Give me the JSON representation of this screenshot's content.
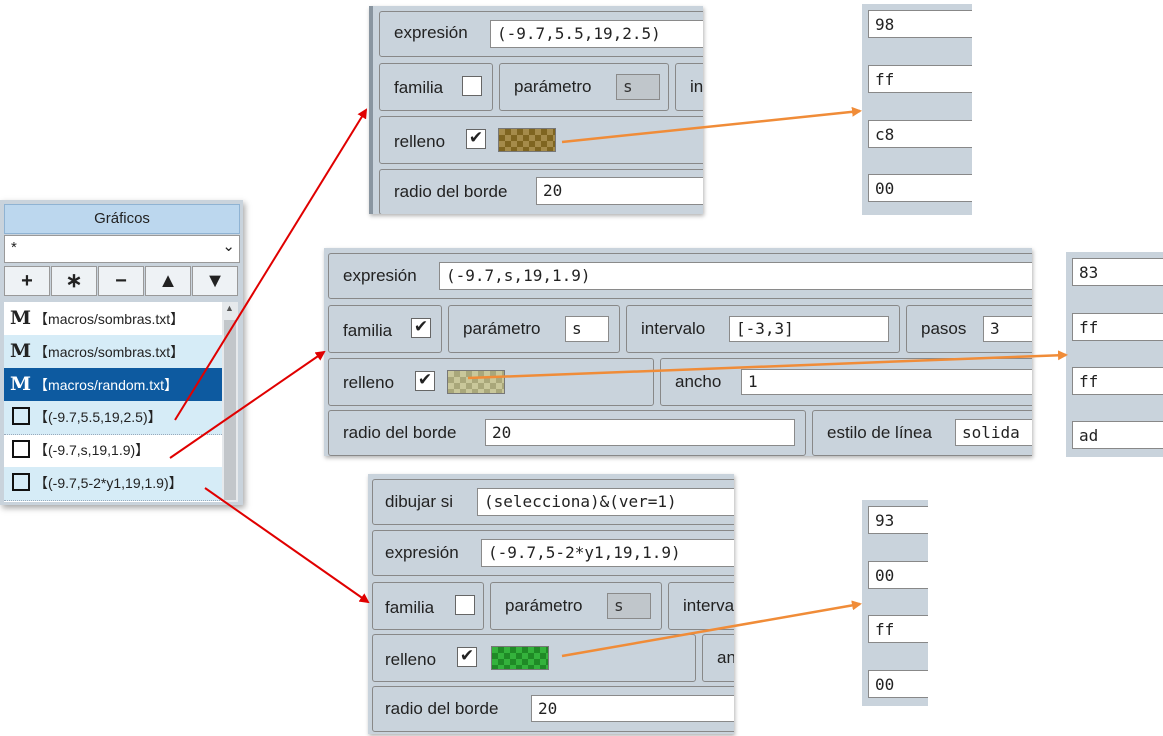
{
  "graficos": {
    "title": "Gráficos",
    "filter_value": "*",
    "toolbar": [
      "+",
      "∗",
      "−",
      "▲",
      "▼"
    ],
    "items": [
      {
        "icon": "M",
        "text": "【macros/sombras.txt】"
      },
      {
        "icon": "M",
        "text": "【macros/sombras.txt】"
      },
      {
        "icon": "M",
        "text": "【macros/random.txt】"
      },
      {
        "icon": "box",
        "text": "【(-9.7,5.5,19,2.5)】"
      },
      {
        "icon": "box",
        "text": "【(-9.7,s,19,1.9)】"
      },
      {
        "icon": "box",
        "text": "【(-9.7,5-2*y1,19,1.9)】"
      }
    ]
  },
  "panel1": {
    "expresion_label": "expresión",
    "expresion_value": "(-9.7,5.5,19,2.5)",
    "familia_label": "familia",
    "familia_checked": "",
    "parametro_label": "parámetro",
    "parametro_value": "s",
    "intervalo_label": "in",
    "relleno_label": "relleno",
    "relleno_check": "✔",
    "radio_label": "radio del borde",
    "radio_value": "20"
  },
  "hex1": [
    "98",
    "ff",
    "c8",
    "00"
  ],
  "panel2": {
    "expresion_label": "expresión",
    "expresion_value": "(-9.7,s,19,1.9)",
    "familia_label": "familia",
    "familia_check": "✔",
    "parametro_label": "parámetro",
    "parametro_value": "s",
    "intervalo_label": "intervalo",
    "intervalo_value": "[-3,3]",
    "pasos_label": "pasos",
    "pasos_value": "3",
    "relleno_label": "relleno",
    "relleno_check": "✔",
    "ancho_label": "ancho",
    "ancho_value": "1",
    "radio_label": "radio del borde",
    "radio_value": "20",
    "estilo_label": "estilo de línea",
    "estilo_value": "solida"
  },
  "hex2": [
    "83",
    "ff",
    "ff",
    "ad"
  ],
  "panel3": {
    "dibujar_label": "dibujar si",
    "dibujar_value": "(selecciona)&(ver=1)",
    "expresion_label": "expresión",
    "expresion_value": "(-9.7,5-2*y1,19,1.9)",
    "familia_label": "familia",
    "parametro_label": "parámetro",
    "parametro_value": "s",
    "intervalo_label": "interva",
    "relleno_label": "relleno",
    "relleno_check": "✔",
    "ancho_label": "an",
    "radio_label": "radio del borde",
    "radio_value": "20"
  },
  "hex3": [
    "93",
    "00",
    "ff",
    "00"
  ],
  "colors": {
    "arrow_red": "#e00000",
    "arrow_orange": "#f08c38",
    "selected": "#0d5aa0",
    "panel_bg": "#c9d3dc"
  }
}
